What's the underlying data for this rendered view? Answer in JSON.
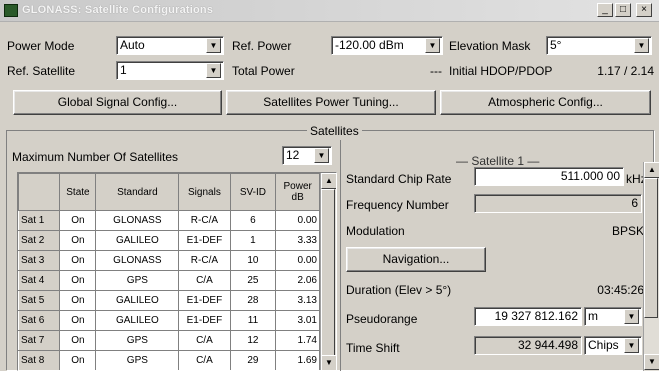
{
  "window": {
    "title": "GLONASS: Satellite Configurations",
    "minimize": "_",
    "maximize": "□",
    "close": "×"
  },
  "top": {
    "power_mode_label": "Power Mode",
    "power_mode_value": "Auto",
    "ref_power_label": "Ref. Power",
    "ref_power_value": "-120.00",
    "ref_power_unit": "dBm",
    "elevation_mask_label": "Elevation Mask",
    "elevation_mask_value": "5°",
    "ref_satellite_label": "Ref. Satellite",
    "ref_satellite_value": "1",
    "total_power_label": "Total Power",
    "total_power_value": "---",
    "hdop_label": "Initial HDOP/PDOP",
    "hdop_value": "1.17 / 2.14"
  },
  "buttons": {
    "global": "Global Signal Config...",
    "power_tuning": "Satellites Power Tuning...",
    "atmospheric": "Atmospheric Config..."
  },
  "satellites": {
    "section_title": "Satellites",
    "max_label": "Maximum Number Of Satellites",
    "max_value": "12",
    "columns": [
      "",
      "State",
      "Standard",
      "Signals",
      "SV-ID",
      "Power dB"
    ],
    "rows": [
      {
        "name": "Sat 1",
        "state": "On",
        "standard": "GLONASS",
        "signals": "R-C/A",
        "svid": "6",
        "power": "0.00"
      },
      {
        "name": "Sat 2",
        "state": "On",
        "standard": "GALILEO",
        "signals": "E1-DEF",
        "svid": "1",
        "power": "3.33"
      },
      {
        "name": "Sat 3",
        "state": "On",
        "standard": "GLONASS",
        "signals": "R-C/A",
        "svid": "10",
        "power": "0.00"
      },
      {
        "name": "Sat 4",
        "state": "On",
        "standard": "GPS",
        "signals": "C/A",
        "svid": "25",
        "power": "2.06"
      },
      {
        "name": "Sat 5",
        "state": "On",
        "standard": "GALILEO",
        "signals": "E1-DEF",
        "svid": "28",
        "power": "3.13"
      },
      {
        "name": "Sat 6",
        "state": "On",
        "standard": "GALILEO",
        "signals": "E1-DEF",
        "svid": "11",
        "power": "3.01"
      },
      {
        "name": "Sat 7",
        "state": "On",
        "standard": "GPS",
        "signals": "C/A",
        "svid": "12",
        "power": "1.74"
      },
      {
        "name": "Sat 8",
        "state": "On",
        "standard": "GPS",
        "signals": "C/A",
        "svid": "29",
        "power": "1.69"
      }
    ]
  },
  "detail": {
    "title": "Satellite 1",
    "chip_rate_label": "Standard Chip Rate",
    "chip_rate_value": "511.000 00",
    "chip_rate_unit": "kHz",
    "freq_label": "Frequency Number",
    "freq_value": "6",
    "modulation_label": "Modulation",
    "modulation_value": "BPSK",
    "navigation_button": "Navigation...",
    "duration_label": "Duration (Elev > 5°)",
    "duration_value": "03:45:26",
    "pseudorange_label": "Pseudorange",
    "pseudorange_value": "19 327 812.162",
    "pseudorange_unit": "m",
    "timeshift_label": "Time Shift",
    "timeshift_value": "32 944.498",
    "timeshift_unit": "Chips"
  }
}
